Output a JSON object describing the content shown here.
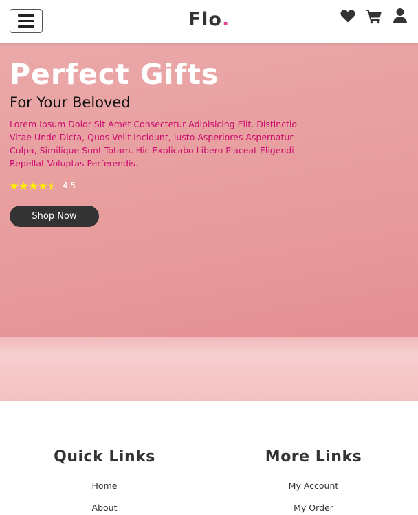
{
  "nav": {
    "brand": "Flo",
    "brand_dot": ".",
    "icons": [
      "heart-icon",
      "cart-icon",
      "user-icon"
    ]
  },
  "hero": {
    "title": "Perfect Gifts",
    "subtitle": "For Your Beloved",
    "text": "Lorem Ipsum Dolor Sit Amet Consectetur Adipisicing Elit. Distinctio Vitae Unde Dicta, Quos Velit Incidunt, Iusto Asperiores Aspernatur Culpa, Similique Sunt Totam. Hic Explicabo Libero Placeat Eligendi Repellat Voluptas Perferendis.",
    "rating": "4.5",
    "rating_fraction": 0.9,
    "button": "Shop Now"
  },
  "footer": {
    "quick_links": {
      "title": "Quick Links",
      "items": [
        "Home",
        "About"
      ]
    },
    "more_links": {
      "title": "More Links",
      "items": [
        "My Account",
        "My Order"
      ]
    }
  },
  "colors": {
    "accent": "#e84393",
    "hero_text": "#cc0a6e",
    "hero_bg": "#e79c9d",
    "button_bg": "#333333",
    "star": "#ffee00"
  }
}
